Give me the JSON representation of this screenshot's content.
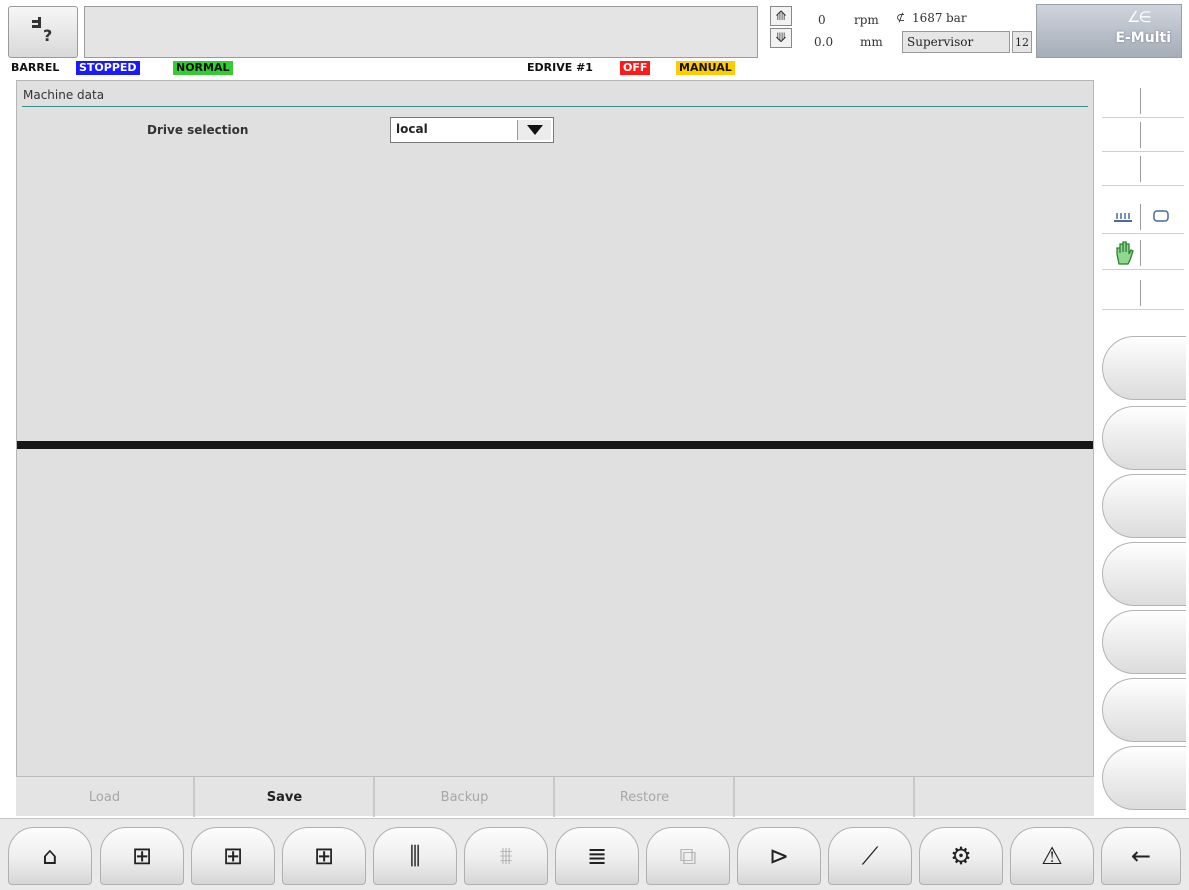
{
  "header": {
    "help_icon": "manual-help-icon",
    "screw_speed_value": "0",
    "screw_speed_unit": "rpm",
    "position_value": "0.0",
    "position_unit": "mm",
    "pressure_value": "1687",
    "pressure_unit": "bar",
    "user_level": "Supervisor",
    "user_number": "12",
    "logo_text": "E-Multi"
  },
  "status": {
    "barrel_label": "BARREL",
    "barrel_state": "STOPPED",
    "barrel_mode": "NORMAL",
    "edrive_label": "EDRIVE #1",
    "edrive_state": "OFF",
    "edrive_mode": "MANUAL",
    "colors": {
      "stopped": "#1a1aff",
      "normal": "#33cc33",
      "off": "#ff1a1a",
      "manual": "#ffcc00"
    }
  },
  "main": {
    "section_title": "Machine data",
    "drive_selection_label": "Drive selection",
    "drive_selection_value": "local"
  },
  "actions": [
    {
      "label": "Load",
      "enabled": false
    },
    {
      "label": "Save",
      "enabled": true
    },
    {
      "label": "Backup",
      "enabled": false
    },
    {
      "label": "Restore",
      "enabled": false
    },
    {
      "label": "",
      "enabled": false
    },
    {
      "label": "",
      "enabled": false
    }
  ],
  "sidebar": {
    "icons": [
      "heater-icon",
      "nozzle-icon",
      "hand-manual-icon"
    ]
  },
  "nav": [
    {
      "icon": "home-icon",
      "glyph": "⌂"
    },
    {
      "icon": "injection-unit-icon",
      "glyph": "⊞"
    },
    {
      "icon": "barrel-heating-icon",
      "glyph": "⊞"
    },
    {
      "icon": "injection-screw-icon",
      "glyph": "⊞"
    },
    {
      "icon": "temperature-zones-icon",
      "glyph": "⫼"
    },
    {
      "icon": "heating-chart-icon",
      "glyph": "⩩"
    },
    {
      "icon": "list-icon",
      "glyph": "≣"
    },
    {
      "icon": "robot-icon",
      "glyph": "⧉"
    },
    {
      "icon": "nozzle-valve-icon",
      "glyph": "⊳"
    },
    {
      "icon": "graph-icon",
      "glyph": "⟋"
    },
    {
      "icon": "settings-gears-icon",
      "glyph": "⚙"
    },
    {
      "icon": "alarm-warning-icon",
      "glyph": "⚠"
    },
    {
      "icon": "back-arrow-icon",
      "glyph": "←"
    }
  ]
}
